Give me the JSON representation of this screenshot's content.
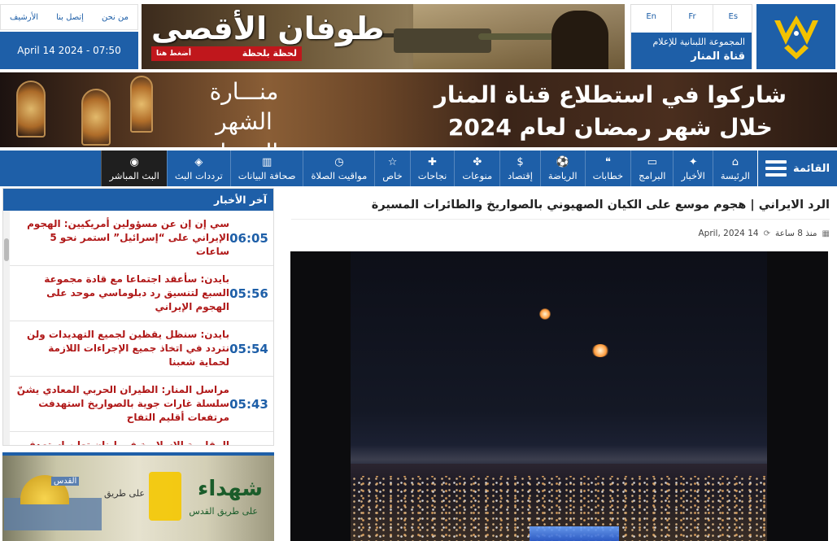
{
  "languages": [
    "En",
    "Fr",
    "Es"
  ],
  "brand": {
    "group": "المجموعة اللبنانية للإعلام",
    "channel": "قناة المنار"
  },
  "top_links": [
    "من نحن",
    "إتصل بنا",
    "الأرشيف"
  ],
  "datetime": "April 14 2024 - 07:50",
  "banner_top": {
    "title": "طوفان الأقصى",
    "subtitle": "لحظة بلحظة",
    "cta": "أضغط هنا"
  },
  "banner_ramadan": {
    "line1": "شاركوا في استطلاع قناة المنار",
    "line2": "خلال شهر رمضان لعام 2024",
    "manara": "منـــارة",
    "manara_sub": "الشهر الفضيل"
  },
  "nav": {
    "menu_label": "القائمة",
    "items": [
      {
        "label": "الرئيسة",
        "icon": "home-icon",
        "glyph": "⌂"
      },
      {
        "label": "الأخبار",
        "icon": "satellite-icon",
        "glyph": "✦"
      },
      {
        "label": "البرامج",
        "icon": "monitor-icon",
        "glyph": "▭"
      },
      {
        "label": "خطابات",
        "icon": "speech-icon",
        "glyph": "❝"
      },
      {
        "label": "الرياضة",
        "icon": "ball-icon",
        "glyph": "⚽"
      },
      {
        "label": "إقتصاد",
        "icon": "money-icon",
        "glyph": "$"
      },
      {
        "label": "منوعات",
        "icon": "variety-icon",
        "glyph": "✤"
      },
      {
        "label": "نجاحات",
        "icon": "success-icon",
        "glyph": "✚"
      },
      {
        "label": "خاص",
        "icon": "star-icon",
        "glyph": "☆"
      },
      {
        "label": "مواقيت الصلاة",
        "icon": "clock-icon",
        "glyph": "◷"
      },
      {
        "label": "صحافة البيانات",
        "icon": "chart-icon",
        "glyph": "▥"
      },
      {
        "label": "ترددات البث",
        "icon": "broadcast-icon",
        "glyph": "◈"
      }
    ],
    "live_label": "البث المباشر",
    "live_glyph": "◉"
  },
  "article": {
    "title": "الرد الايراني | هجوم موسع على الكيان الصهيوني بالصواريخ والطائرات المسيرة",
    "ago": "منذ 8 ساعة",
    "date": "April, 2024 14"
  },
  "latest_news": {
    "heading": "آخر الأخبار",
    "items": [
      {
        "time": "06:05",
        "text": "سي إن إن عن مسؤولين أمريكيين: الهجوم الإيراني على “إسرائيل” استمر نحو 5 ساعات"
      },
      {
        "time": "05:56",
        "text": "بايدن: سأعقد اجتماعا مع قادة مجموعة السبع لتنسيق رد دبلوماسي موحد على الهجوم الإيراني"
      },
      {
        "time": "05:54",
        "text": "بايدن: سنظل يقظين لجميع التهديدات ولن نتردد في اتخاذ جميع الإجراءات اللازمة لحماية شعبنا"
      },
      {
        "time": "05:43",
        "text": "مراسل المنار: الطيران الحربي المعادي يشنّ سلسلة غارات جوية بالصواريخ استهدفت مرتفعات أقليم التفاح"
      },
      {
        "time": "",
        "text": "المقاومة الاسلامية في لبنان تعلن استهدف"
      }
    ]
  },
  "ad_shuhada": {
    "title": "شهداء",
    "sub": "على طريق القدس",
    "left": "على طريق",
    "tag": "القدس"
  }
}
